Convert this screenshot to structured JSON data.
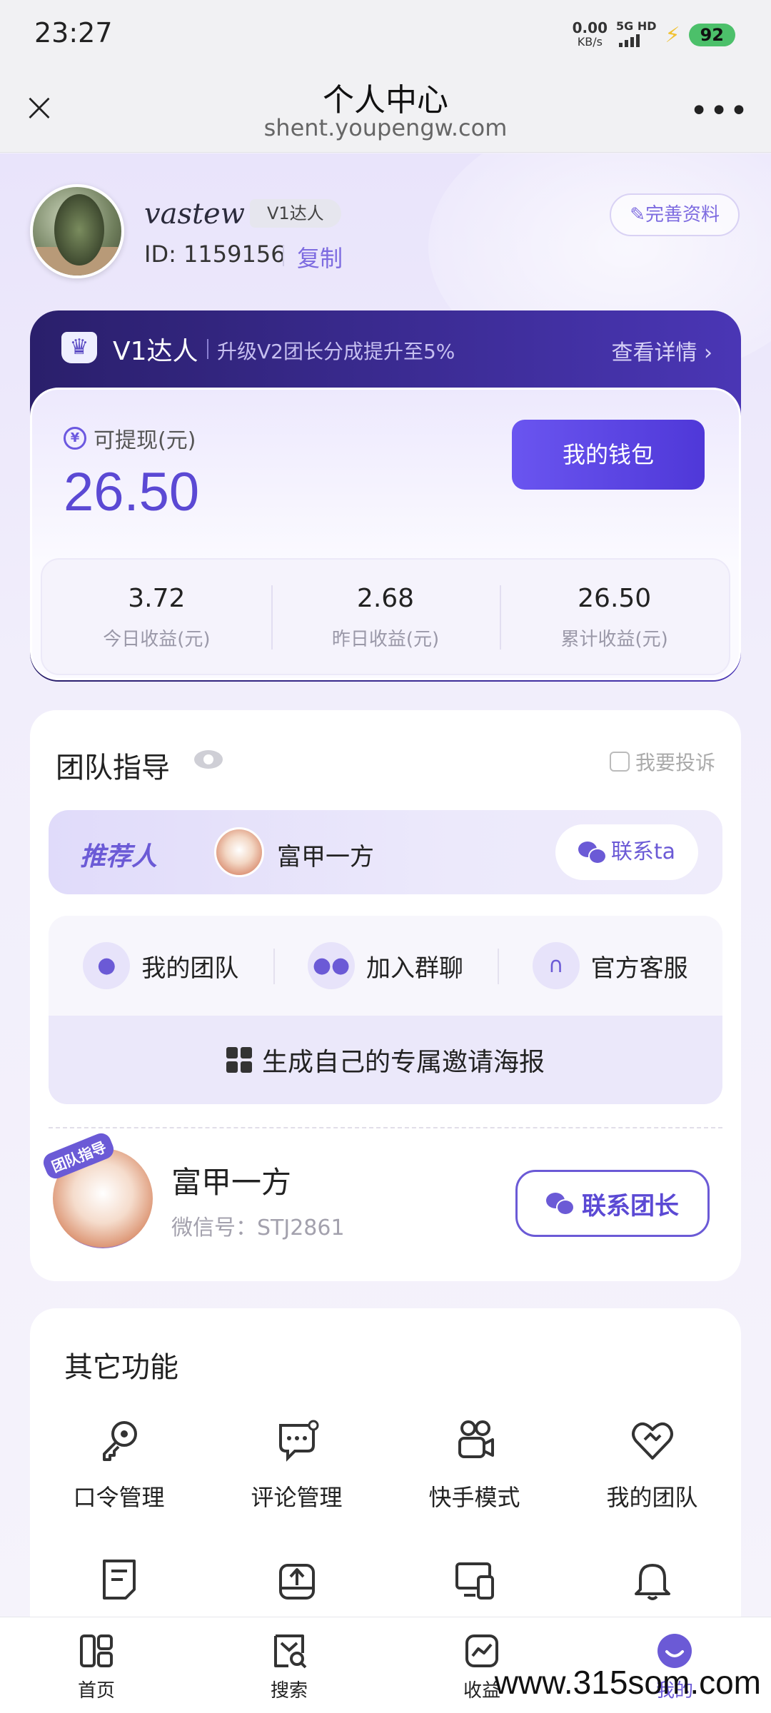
{
  "status_bar": {
    "time": "23:27",
    "net_speed": "0.00",
    "net_unit": "KB/s",
    "network": "5G HD",
    "battery": "92"
  },
  "nav": {
    "title": "个人中心",
    "subtitle": "shent.youpengw.com"
  },
  "profile": {
    "username": "vastew",
    "level_tag": "V1达人",
    "id_text": "ID: 1159156",
    "copy_label": "复制",
    "complete_label": "完善资料"
  },
  "vip": {
    "title": "V1达人",
    "desc": "升级V2团长分成提升至5%",
    "detail_label": "查看详情 ›"
  },
  "wallet": {
    "withdraw_label": "可提现(元)",
    "withdraw_amount": "26.50",
    "wallet_button": "我的钱包",
    "stats": [
      {
        "value": "3.72",
        "label": "今日收益(元)"
      },
      {
        "value": "2.68",
        "label": "昨日收益(元)"
      },
      {
        "value": "26.50",
        "label": "累计收益(元)"
      }
    ]
  },
  "team": {
    "title": "团队指导",
    "complain_label": "我要投诉",
    "referrer_label": "推荐人",
    "referrer_name": "富甲一方",
    "contact_ta": "联系ta",
    "actions": [
      {
        "label": "我的团队",
        "icon": "user-icon"
      },
      {
        "label": "加入群聊",
        "icon": "wechat-icon"
      },
      {
        "label": "官方客服",
        "icon": "headset-icon"
      }
    ],
    "poster_label": "生成自己的专属邀请海报",
    "leader_badge": "团队指导",
    "leader_name": "富甲一方",
    "leader_wechat": "微信号：STJ2861",
    "contact_leader": "联系团长"
  },
  "other": {
    "title": "其它功能",
    "items": [
      {
        "label": "口令管理",
        "icon": "key-icon"
      },
      {
        "label": "评论管理",
        "icon": "comment-icon"
      },
      {
        "label": "快手模式",
        "icon": "camera-icon"
      },
      {
        "label": "我的团队",
        "icon": "heart-icon"
      },
      {
        "label": "",
        "icon": "document-icon"
      },
      {
        "label": "",
        "icon": "upload-icon"
      },
      {
        "label": "",
        "icon": "devices-icon"
      },
      {
        "label": "",
        "icon": "bell-icon"
      }
    ]
  },
  "tabbar": {
    "items": [
      {
        "label": "首页",
        "icon": "home-icon"
      },
      {
        "label": "搜索",
        "icon": "search-icon"
      },
      {
        "label": "收益",
        "icon": "chart-icon"
      },
      {
        "label": "我的",
        "icon": "profile-icon"
      }
    ],
    "active_index": 3
  },
  "watermark": "www.315som.com",
  "colors": {
    "accent": "#6b5ad6",
    "vip_dark": "#2a1f6b"
  }
}
